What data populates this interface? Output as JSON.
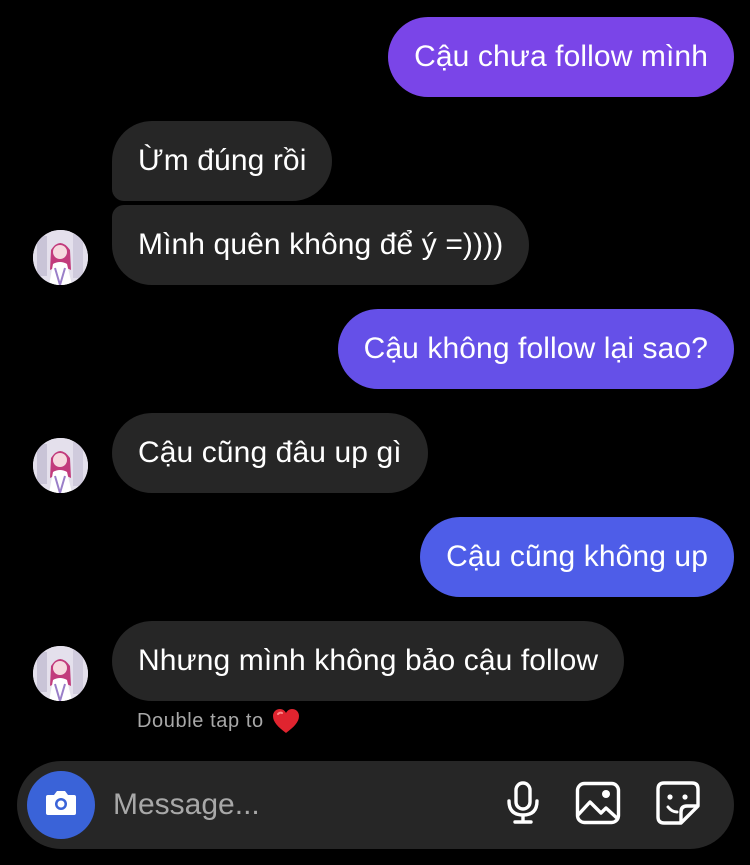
{
  "conversation": {
    "messages": [
      {
        "sender": "me",
        "text": "Cậu chưa follow mình",
        "color": "#7a45e8"
      },
      {
        "sender": "them",
        "text": "Ừm đúng rồi"
      },
      {
        "sender": "them",
        "text": "Mình quên không để ý =))))"
      },
      {
        "sender": "me",
        "text": "Cậu không follow lại sao?",
        "color": "#6550e8"
      },
      {
        "sender": "them",
        "text": "Cậu cũng đâu up gì"
      },
      {
        "sender": "me",
        "text": "Cậu cũng không up",
        "color": "#4e5de8"
      },
      {
        "sender": "them",
        "text": "Nhưng mình không bảo cậu follow"
      }
    ],
    "reaction_hint": "Double tap to",
    "reaction_icon": "heart-icon"
  },
  "composer": {
    "placeholder": "Message...",
    "camera_icon": "camera-icon",
    "tools": [
      "microphone-icon",
      "image-icon",
      "sticker-icon"
    ],
    "camera_color": "#3a63d8"
  }
}
